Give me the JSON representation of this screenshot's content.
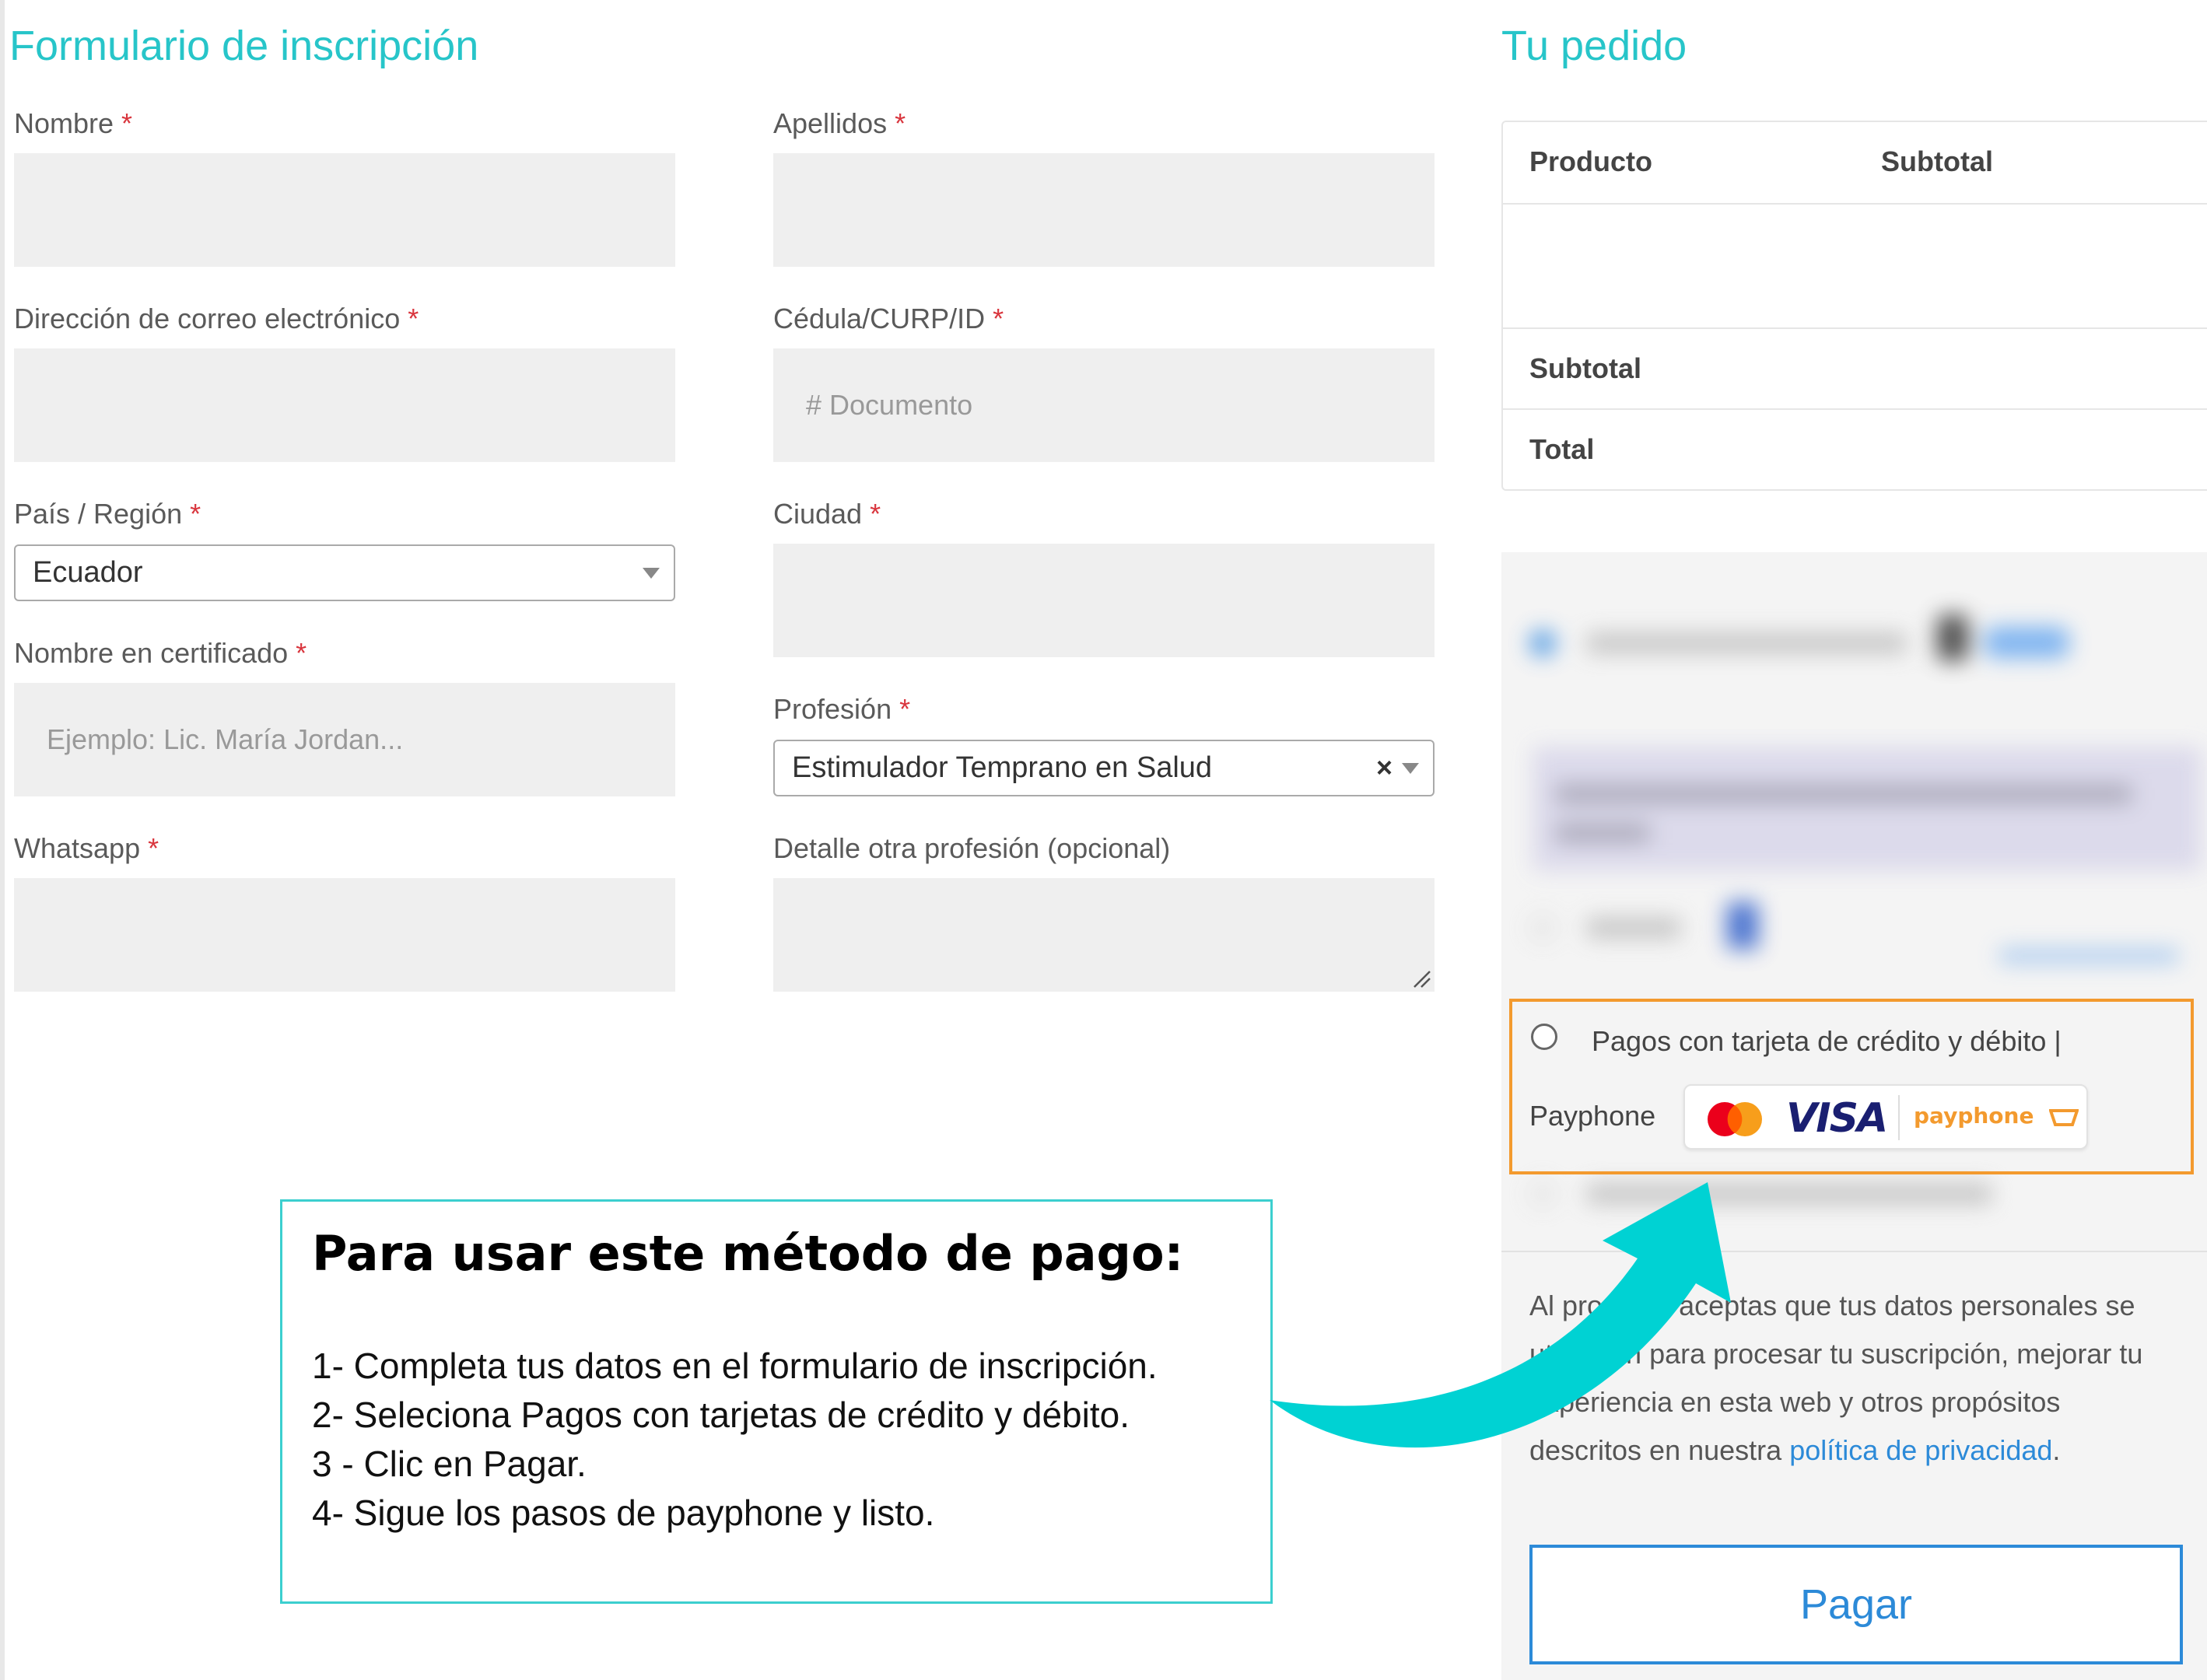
{
  "form": {
    "title": "Formulario de inscripción",
    "required_mark": "*",
    "fields": {
      "nombre": {
        "label": "Nombre",
        "value": ""
      },
      "apellidos": {
        "label": "Apellidos",
        "value": ""
      },
      "email": {
        "label": "Dirección de correo electrónico",
        "value": ""
      },
      "cedula": {
        "label": "Cédula/CURP/ID",
        "placeholder": "# Documento"
      },
      "pais": {
        "label": "País / Región",
        "value": "Ecuador"
      },
      "ciudad": {
        "label": "Ciudad",
        "value": ""
      },
      "certificado": {
        "label": "Nombre en certificado",
        "placeholder": "Ejemplo: Lic. María Jordan..."
      },
      "profesion": {
        "label": "Profesión",
        "value": "Estimulador Temprano en Salud",
        "clear": "×"
      },
      "whatsapp": {
        "label": "Whatsapp",
        "value": ""
      },
      "detalle": {
        "label": "Detalle otra profesión (opcional)",
        "value": ""
      }
    }
  },
  "order": {
    "title": "Tu pedido",
    "col_product": "Producto",
    "col_subtotal": "Subtotal",
    "row_subtotal": "Subtotal",
    "row_total": "Total"
  },
  "payment": {
    "payphone_option_line1": "Pagos con tarjeta de crédito y débito |",
    "payphone_option_line2": "Payphone",
    "visa_text": "VISA",
    "payphone_brand": "payphone",
    "privacy_pre": "Al procesar aceptas que tus datos personales se utilizarán para procesar tu suscripción, mejorar tu experiencia en esta web y otros propósitos descritos en nuestra ",
    "privacy_link": "política de privacidad",
    "privacy_post": ".",
    "pay_button": "Pagar"
  },
  "instructions": {
    "title": "Para usar este método de pago:",
    "steps": [
      "1- Completa tus datos en el formulario de inscripción.",
      "2- Seleciona Pagos con tarjetas de crédito y débito.",
      "3 - Clic en Pagar.",
      "4- Sigue los pasos de payphone y listo."
    ]
  },
  "colors": {
    "accent": "#27c5c9",
    "required": "#d9363e",
    "highlight_border": "#f39a2e",
    "link": "#2c8ad8",
    "arrow": "#00d2d3"
  }
}
